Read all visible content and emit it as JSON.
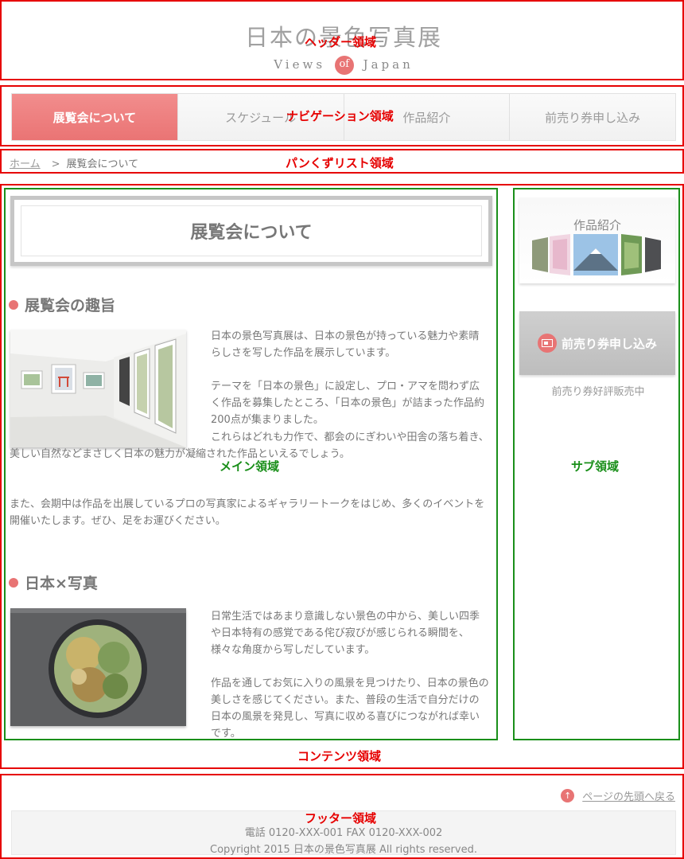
{
  "labels": {
    "header": "ヘッダー領域",
    "nav": "ナビゲーション領域",
    "breadcrumb": "パンくずリスト領域",
    "main": "メイン領域",
    "sub": "サブ領域",
    "content": "コンテンツ領域",
    "footer": "フッター領域"
  },
  "header": {
    "title": "日本の景色写真展",
    "subtitle_pre": "Views",
    "subtitle_of": "of",
    "subtitle_post": "Japan"
  },
  "nav": {
    "items": [
      {
        "label": "展覧会について"
      },
      {
        "label": "スケジュール"
      },
      {
        "label": "作品紹介"
      },
      {
        "label": "前売り券申し込み"
      }
    ]
  },
  "breadcrumb": {
    "home": "ホーム",
    "separator": ">",
    "current": "展覧会について"
  },
  "main": {
    "page_title": "展覧会について",
    "sections": [
      {
        "heading": "展覧会の趣旨",
        "paragraphs": [
          "日本の景色写真展は、日本の景色が持っている魅力や素晴らしさを写した作品を展示しています。",
          "テーマを「日本の景色」に設定し、プロ・アマを問わず広く作品を募集したところ、「日本の景色」が詰まった作品約200点が集まりました。",
          "これらはどれも力作で、都会のにぎわいや田舎の落ち着き、美しい自然などまさしく日本の魅力が凝縮された作品といえるでしょう。",
          "また、会期中は作品を出展しているプロの写真家によるギャラリートークをはじめ、多くのイベントを開催いたします。ぜひ、足をお運びください。"
        ]
      },
      {
        "heading": "日本×写真",
        "paragraphs": [
          "日常生活ではあまり意識しない景色の中から、美しい四季や日本特有の感覚である侘び寂びが感じられる瞬間を、様々な角度から写しだしています。",
          "作品を通してお気に入りの風景を見つけたり、日本の景色の美しさを感じてください。また、普段の生活で自分だけの日本の風景を発見し、写真に収める喜びにつながれば幸いです。"
        ]
      }
    ]
  },
  "sub": {
    "works_title": "作品紹介",
    "ticket_banner": "前売り券申し込み",
    "ticket_note": "前売り券好評販売中"
  },
  "footer": {
    "to_top": "ページの先頭へ戻る",
    "contact": "電話 0120-XXX-001 FAX 0120-XXX-002",
    "copyright": "Copyright 2015 日本の景色写真展 All rights reserved."
  },
  "colors": {
    "accent": "#e87474",
    "region_outline": "#e60000",
    "sub_region_outline": "#1a8f1a"
  }
}
